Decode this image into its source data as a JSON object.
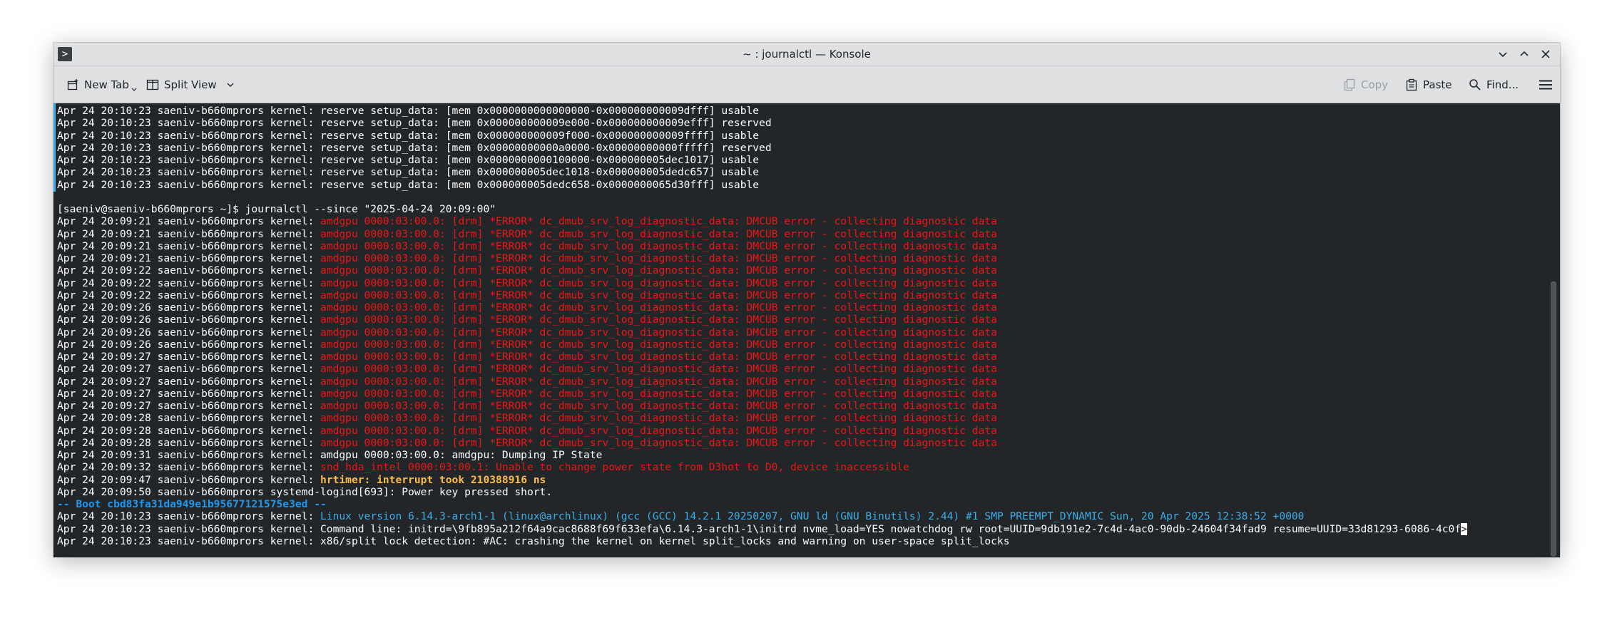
{
  "window": {
    "title": "~ : journalctl — Konsole",
    "app_icon_glyph": ">"
  },
  "toolbar": {
    "new_tab": "New Tab",
    "split_view": "Split View",
    "copy": "Copy",
    "paste": "Paste",
    "find": "Find..."
  },
  "terminal": {
    "lines": [
      [
        {
          "t": "Apr 24 20:10:23 saeniv-b660mprors kernel: reserve setup_data: [mem 0x0000000000000000-0x000000000009dfff] usable",
          "c": ""
        }
      ],
      [
        {
          "t": "Apr 24 20:10:23 saeniv-b660mprors kernel: reserve setup_data: [mem 0x000000000009e000-0x000000000009efff] reserved",
          "c": ""
        }
      ],
      [
        {
          "t": "Apr 24 20:10:23 saeniv-b660mprors kernel: reserve setup_data: [mem 0x000000000009f000-0x000000000009ffff] usable",
          "c": ""
        }
      ],
      [
        {
          "t": "Apr 24 20:10:23 saeniv-b660mprors kernel: reserve setup_data: [mem 0x00000000000a0000-0x00000000000fffff] reserved",
          "c": ""
        }
      ],
      [
        {
          "t": "Apr 24 20:10:23 saeniv-b660mprors kernel: reserve setup_data: [mem 0x0000000000100000-0x000000005dec1017] usable",
          "c": ""
        }
      ],
      [
        {
          "t": "Apr 24 20:10:23 saeniv-b660mprors kernel: reserve setup_data: [mem 0x000000005dec1018-0x000000005dedc657] usable",
          "c": ""
        }
      ],
      [
        {
          "t": "Apr 24 20:10:23 saeniv-b660mprors kernel: reserve setup_data: [mem 0x000000005dedc658-0x0000000065d30fff] usable",
          "c": ""
        }
      ],
      [
        {
          "t": "",
          "c": ""
        }
      ],
      [
        {
          "t": "[saeniv@saeniv-b660mprors ~]$ journalctl --since \"2025-04-24 20:09:00\"",
          "c": ""
        }
      ],
      [
        {
          "t": "Apr 24 20:09:21 saeniv-b660mprors kernel: ",
          "c": ""
        },
        {
          "t": "amdgpu 0000:03:00.0: [drm] *ERROR* dc_dmub_srv_log_diagnostic_data: DMCUB error - collecting diagnostic data",
          "c": "red"
        }
      ],
      [
        {
          "t": "Apr 24 20:09:21 saeniv-b660mprors kernel: ",
          "c": ""
        },
        {
          "t": "amdgpu 0000:03:00.0: [drm] *ERROR* dc_dmub_srv_log_diagnostic_data: DMCUB error - collecting diagnostic data",
          "c": "red"
        }
      ],
      [
        {
          "t": "Apr 24 20:09:21 saeniv-b660mprors kernel: ",
          "c": ""
        },
        {
          "t": "amdgpu 0000:03:00.0: [drm] *ERROR* dc_dmub_srv_log_diagnostic_data: DMCUB error - collecting diagnostic data",
          "c": "red"
        }
      ],
      [
        {
          "t": "Apr 24 20:09:21 saeniv-b660mprors kernel: ",
          "c": ""
        },
        {
          "t": "amdgpu 0000:03:00.0: [drm] *ERROR* dc_dmub_srv_log_diagnostic_data: DMCUB error - collecting diagnostic data",
          "c": "red"
        }
      ],
      [
        {
          "t": "Apr 24 20:09:22 saeniv-b660mprors kernel: ",
          "c": ""
        },
        {
          "t": "amdgpu 0000:03:00.0: [drm] *ERROR* dc_dmub_srv_log_diagnostic_data: DMCUB error - collecting diagnostic data",
          "c": "red"
        }
      ],
      [
        {
          "t": "Apr 24 20:09:22 saeniv-b660mprors kernel: ",
          "c": ""
        },
        {
          "t": "amdgpu 0000:03:00.0: [drm] *ERROR* dc_dmub_srv_log_diagnostic_data: DMCUB error - collecting diagnostic data",
          "c": "red"
        }
      ],
      [
        {
          "t": "Apr 24 20:09:22 saeniv-b660mprors kernel: ",
          "c": ""
        },
        {
          "t": "amdgpu 0000:03:00.0: [drm] *ERROR* dc_dmub_srv_log_diagnostic_data: DMCUB error - collecting diagnostic data",
          "c": "red"
        }
      ],
      [
        {
          "t": "Apr 24 20:09:26 saeniv-b660mprors kernel: ",
          "c": ""
        },
        {
          "t": "amdgpu 0000:03:00.0: [drm] *ERROR* dc_dmub_srv_log_diagnostic_data: DMCUB error - collecting diagnostic data",
          "c": "red"
        }
      ],
      [
        {
          "t": "Apr 24 20:09:26 saeniv-b660mprors kernel: ",
          "c": ""
        },
        {
          "t": "amdgpu 0000:03:00.0: [drm] *ERROR* dc_dmub_srv_log_diagnostic_data: DMCUB error - collecting diagnostic data",
          "c": "red"
        }
      ],
      [
        {
          "t": "Apr 24 20:09:26 saeniv-b660mprors kernel: ",
          "c": ""
        },
        {
          "t": "amdgpu 0000:03:00.0: [drm] *ERROR* dc_dmub_srv_log_diagnostic_data: DMCUB error - collecting diagnostic data",
          "c": "red"
        }
      ],
      [
        {
          "t": "Apr 24 20:09:26 saeniv-b660mprors kernel: ",
          "c": ""
        },
        {
          "t": "amdgpu 0000:03:00.0: [drm] *ERROR* dc_dmub_srv_log_diagnostic_data: DMCUB error - collecting diagnostic data",
          "c": "red"
        }
      ],
      [
        {
          "t": "Apr 24 20:09:27 saeniv-b660mprors kernel: ",
          "c": ""
        },
        {
          "t": "amdgpu 0000:03:00.0: [drm] *ERROR* dc_dmub_srv_log_diagnostic_data: DMCUB error - collecting diagnostic data",
          "c": "red"
        }
      ],
      [
        {
          "t": "Apr 24 20:09:27 saeniv-b660mprors kernel: ",
          "c": ""
        },
        {
          "t": "amdgpu 0000:03:00.0: [drm] *ERROR* dc_dmub_srv_log_diagnostic_data: DMCUB error - collecting diagnostic data",
          "c": "red"
        }
      ],
      [
        {
          "t": "Apr 24 20:09:27 saeniv-b660mprors kernel: ",
          "c": ""
        },
        {
          "t": "amdgpu 0000:03:00.0: [drm] *ERROR* dc_dmub_srv_log_diagnostic_data: DMCUB error - collecting diagnostic data",
          "c": "red"
        }
      ],
      [
        {
          "t": "Apr 24 20:09:27 saeniv-b660mprors kernel: ",
          "c": ""
        },
        {
          "t": "amdgpu 0000:03:00.0: [drm] *ERROR* dc_dmub_srv_log_diagnostic_data: DMCUB error - collecting diagnostic data",
          "c": "red"
        }
      ],
      [
        {
          "t": "Apr 24 20:09:27 saeniv-b660mprors kernel: ",
          "c": ""
        },
        {
          "t": "amdgpu 0000:03:00.0: [drm] *ERROR* dc_dmub_srv_log_diagnostic_data: DMCUB error - collecting diagnostic data",
          "c": "red"
        }
      ],
      [
        {
          "t": "Apr 24 20:09:28 saeniv-b660mprors kernel: ",
          "c": ""
        },
        {
          "t": "amdgpu 0000:03:00.0: [drm] *ERROR* dc_dmub_srv_log_diagnostic_data: DMCUB error - collecting diagnostic data",
          "c": "red"
        }
      ],
      [
        {
          "t": "Apr 24 20:09:28 saeniv-b660mprors kernel: ",
          "c": ""
        },
        {
          "t": "amdgpu 0000:03:00.0: [drm] *ERROR* dc_dmub_srv_log_diagnostic_data: DMCUB error - collecting diagnostic data",
          "c": "red"
        }
      ],
      [
        {
          "t": "Apr 24 20:09:28 saeniv-b660mprors kernel: ",
          "c": ""
        },
        {
          "t": "amdgpu 0000:03:00.0: [drm] *ERROR* dc_dmub_srv_log_diagnostic_data: DMCUB error - collecting diagnostic data",
          "c": "red"
        }
      ],
      [
        {
          "t": "Apr 24 20:09:31 saeniv-b660mprors kernel: amdgpu 0000:03:00.0: amdgpu: Dumping IP State",
          "c": ""
        }
      ],
      [
        {
          "t": "Apr 24 20:09:32 saeniv-b660mprors kernel: ",
          "c": ""
        },
        {
          "t": "snd_hda_intel 0000:03:00.1: Unable to change power state from D3hot to D0, device inaccessible",
          "c": "red"
        }
      ],
      [
        {
          "t": "Apr 24 20:09:47 saeniv-b660mprors kernel: ",
          "c": ""
        },
        {
          "t": "hrtimer: interrupt took 210388916 ns",
          "c": "yellow"
        }
      ],
      [
        {
          "t": "Apr 24 20:09:50 saeniv-b660mprors systemd-logind[693]: Power key pressed short.",
          "c": ""
        }
      ],
      [
        {
          "t": "-- Boot cbd83fa31da949e1b95677121575e3ed --",
          "c": "blue"
        }
      ],
      [
        {
          "t": "Apr 24 20:10:23 saeniv-b660mprors kernel: ",
          "c": ""
        },
        {
          "t": "Linux version 6.14.3-arch1-1 (linux@archlinux) (gcc (GCC) 14.2.1 20250207, GNU ld (GNU Binutils) 2.44) #1 SMP PREEMPT_DYNAMIC Sun, 20 Apr 2025 12:38:52 +0000",
          "c": "bright-blue"
        }
      ],
      [
        {
          "t": "Apr 24 20:10:23 saeniv-b660mprors kernel: Command line: initrd=\\9fb895a212f64a9cac8688f69f633efa\\6.14.3-arch1-1\\initrd nvme_load=YES nowatchdog rw root=UUID=9db191e2-7c4d-4ac0-90db-24604f34fad9 resume=UUID=33d81293-6086-4c0f",
          "c": ""
        },
        {
          "t": ">",
          "c": "cursor"
        }
      ],
      [
        {
          "t": "Apr 24 20:10:23 saeniv-b660mprors kernel: x86/split lock detection: #AC: crashing the kernel on kernel split_locks and warning on user-space split_locks",
          "c": ""
        }
      ]
    ]
  }
}
